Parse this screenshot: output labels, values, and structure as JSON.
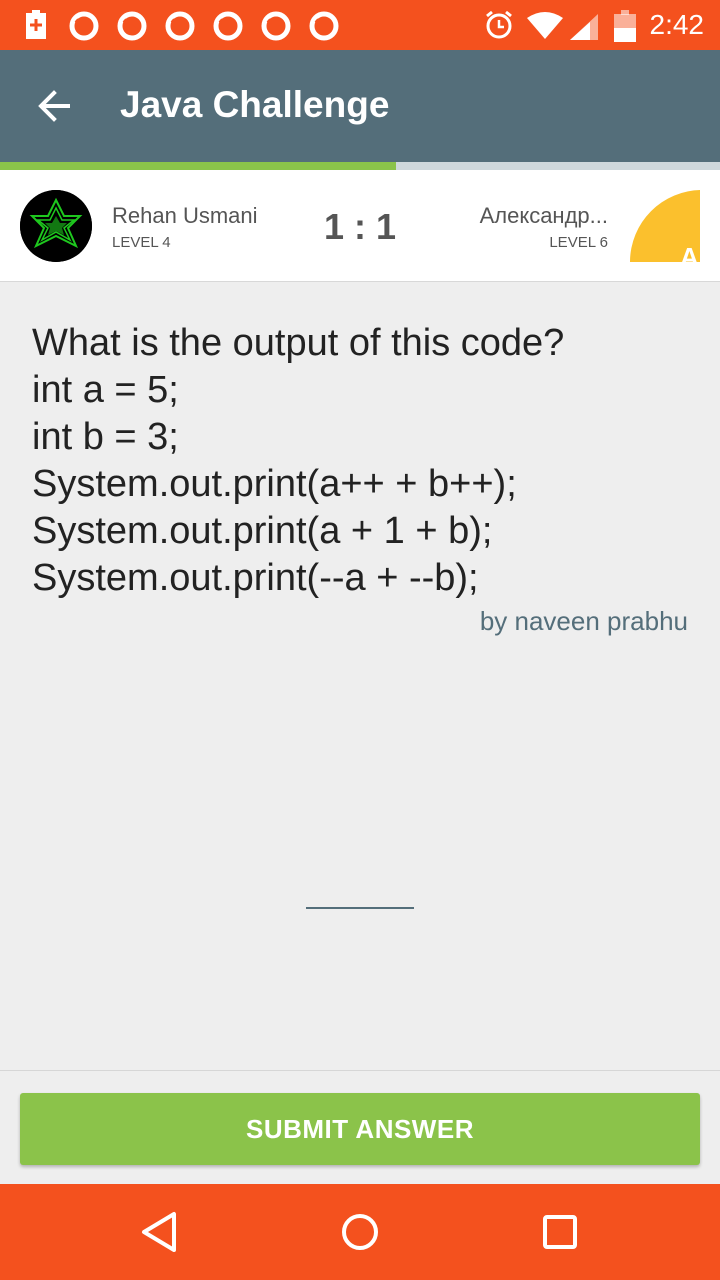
{
  "status_bar": {
    "time": "2:42",
    "icons": [
      "battery-charging-icon",
      "notification-icon",
      "notification-icon",
      "notification-icon",
      "notification-icon",
      "notification-icon",
      "notification-icon",
      "alarm-icon",
      "wifi-icon",
      "signal-icon",
      "battery-icon"
    ]
  },
  "toolbar": {
    "title": "Java Challenge",
    "back_icon": "arrow-back-icon"
  },
  "progress": {
    "fraction": 0.55
  },
  "players": {
    "left": {
      "name": "Rehan Usmani",
      "level": "LEVEL 4"
    },
    "score": "1 : 1",
    "right": {
      "name": "Александр...",
      "level": "LEVEL 6",
      "avatar_letter": "A"
    }
  },
  "question": {
    "text": "What is the output of this code?\nint a = 5;\nint b = 3;\nSystem.out.print(a++ + b++);\nSystem.out.print(a + 1 + b);\nSystem.out.print(--a + --b);",
    "author": "by naveen prabhu"
  },
  "answer": {
    "value": ""
  },
  "submit": {
    "label": "SUBMIT ANSWER"
  },
  "nav": {
    "back": "nav-back-icon",
    "home": "nav-home-icon",
    "recents": "nav-recents-icon"
  },
  "colors": {
    "status": "#f4511e",
    "toolbar": "#546e7a",
    "accent": "#8bc34a"
  }
}
